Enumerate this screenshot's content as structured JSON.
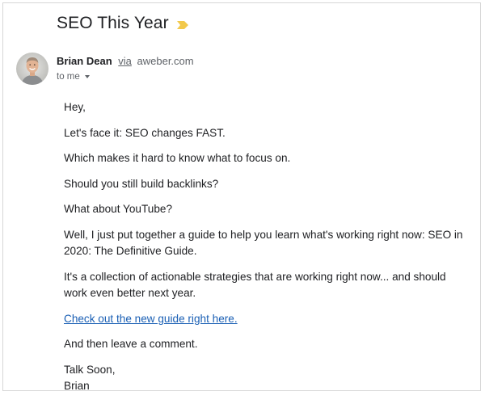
{
  "email": {
    "subject": "SEO This Year",
    "importance_icon": "importance-marker-icon",
    "importance_color": "#f2c94c",
    "sender": {
      "name": "Brian Dean",
      "via_label": "via",
      "via_domain": "aweber.com"
    },
    "recipient_label": "to me",
    "body": {
      "greeting": "Hey,",
      "p1": "Let's face it: SEO changes FAST.",
      "p2": "Which makes it hard to know what to focus on.",
      "p3": "Should you still build backlinks?",
      "p4": "What about YouTube?",
      "p5": "Well, I just put together a guide to help you learn what's working right now: SEO in 2020: The Definitive Guide.",
      "p6": "It's a collection of actionable strategies that are working right now... and should work even better next year.",
      "link_text": "Check out the new guide right here.",
      "p7": "And then leave a comment.",
      "signoff": "Talk Soon,",
      "signature": "Brian"
    }
  },
  "colors": {
    "link": "#1a5fb4",
    "text": "#202124",
    "secondary_text": "#5f6368"
  }
}
